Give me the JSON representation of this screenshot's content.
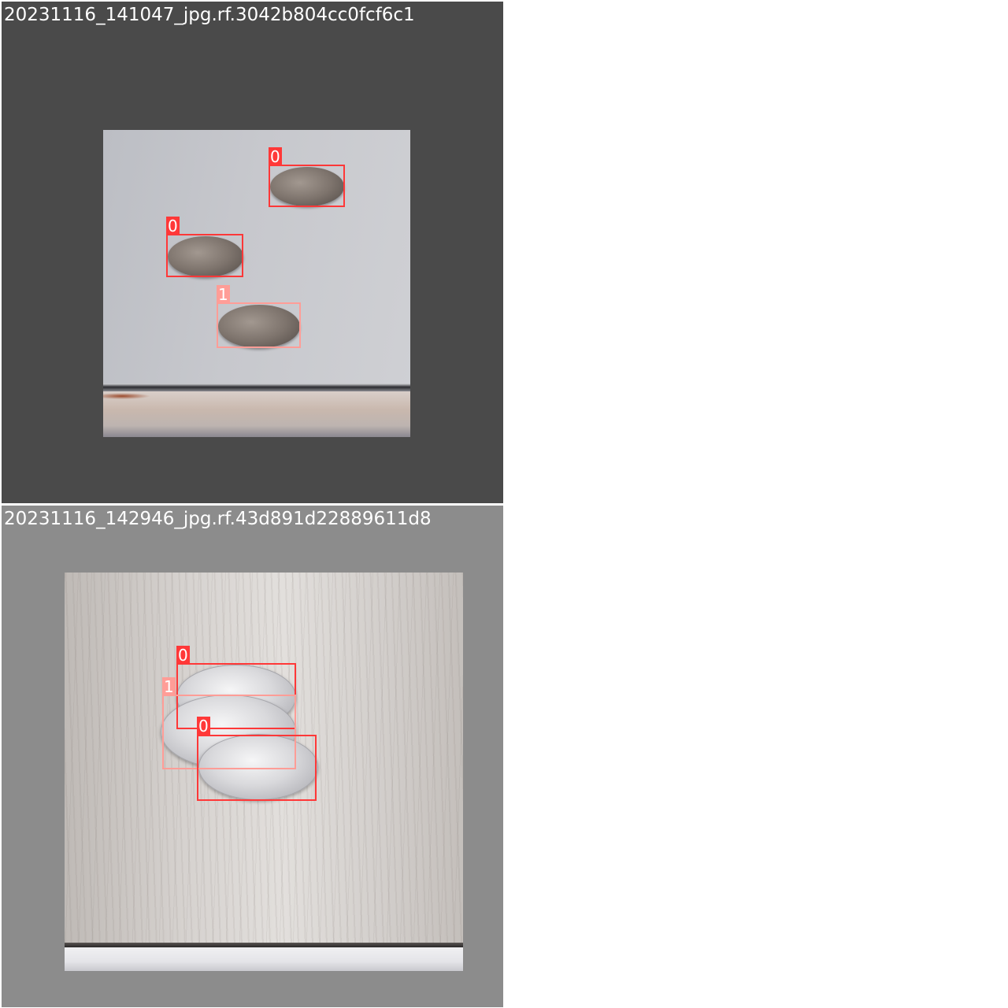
{
  "colors": {
    "class_0": "#ff3838",
    "class_1": "#ff9d97"
  },
  "tiles": [
    {
      "title": "20231116_141047_jpg.rf.3042b804cc0fcf6c1",
      "detections": [
        {
          "label": "0"
        },
        {
          "label": "0"
        },
        {
          "label": "1"
        }
      ]
    },
    {
      "title": "20231116_142946_jpg.rf.43d891d22889611d8",
      "detections": [
        {
          "label": "0"
        },
        {
          "label": "1"
        },
        {
          "label": "0"
        }
      ]
    }
  ]
}
